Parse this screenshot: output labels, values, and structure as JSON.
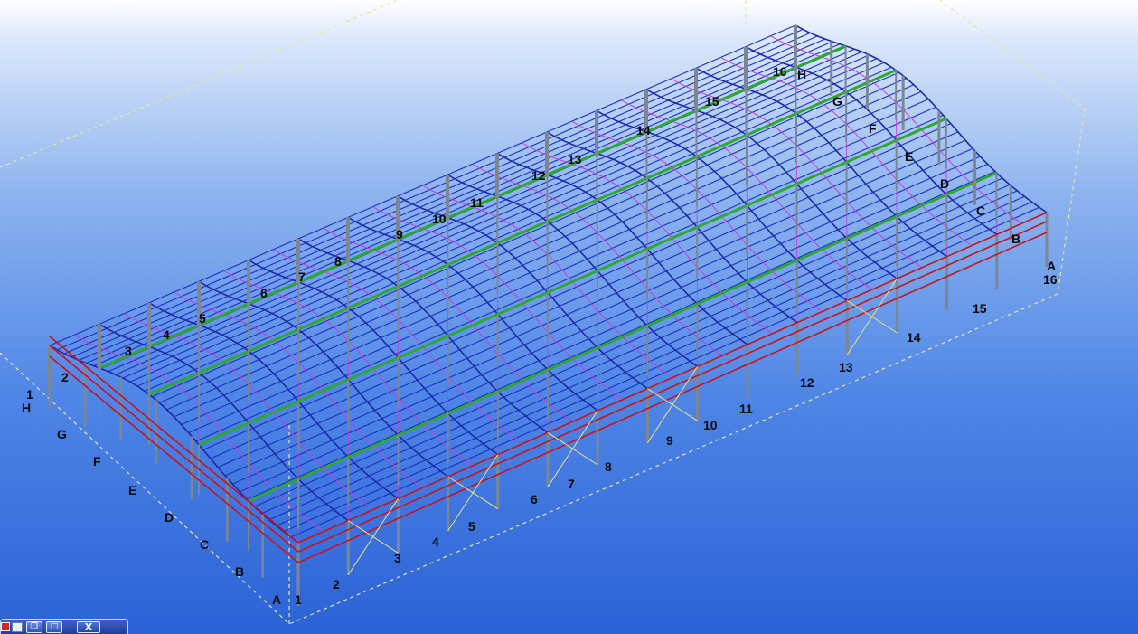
{
  "viewport": {
    "background_top": "#ffffff",
    "background_bottom": "#2b62d6"
  },
  "model_colors": {
    "rafter": "#1e2aa6",
    "purlin": "#1b2fc4",
    "secondary": "#c040d8",
    "eave_beam": "#c8141e",
    "ridge_beam": "#2da832",
    "column": "#7d8794",
    "bracing": "#e8e08a",
    "work_area": "#e6e6a0"
  },
  "grid_labels_axis": [
    {
      "text": "1"
    },
    {
      "text": "2"
    },
    {
      "text": "3"
    },
    {
      "text": "4"
    },
    {
      "text": "5"
    },
    {
      "text": "6"
    },
    {
      "text": "7"
    },
    {
      "text": "8"
    },
    {
      "text": "9"
    },
    {
      "text": "10"
    },
    {
      "text": "11"
    },
    {
      "text": "12"
    },
    {
      "text": "13"
    },
    {
      "text": "14"
    },
    {
      "text": "15"
    },
    {
      "text": "16"
    }
  ],
  "grid_labels_axis_far": [
    {
      "text": "2"
    },
    {
      "text": "3"
    },
    {
      "text": "4"
    },
    {
      "text": "5"
    },
    {
      "text": "6"
    },
    {
      "text": "7"
    },
    {
      "text": "8"
    },
    {
      "text": "9"
    },
    {
      "text": "10"
    },
    {
      "text": "11"
    },
    {
      "text": "12"
    },
    {
      "text": "13"
    },
    {
      "text": "14"
    },
    {
      "text": "15"
    },
    {
      "text": "16"
    }
  ],
  "grid_labels_letters_left": [
    {
      "text": "A"
    },
    {
      "text": "B"
    },
    {
      "text": "C"
    },
    {
      "text": "D"
    },
    {
      "text": "E"
    },
    {
      "text": "F"
    },
    {
      "text": "G"
    },
    {
      "text": "H"
    }
  ],
  "grid_labels_letters_right": [
    {
      "text": "A"
    },
    {
      "text": "B"
    },
    {
      "text": "C"
    },
    {
      "text": "D"
    },
    {
      "text": "E"
    },
    {
      "text": "F"
    },
    {
      "text": "G"
    },
    {
      "text": "H"
    }
  ],
  "left_top_label": "1",
  "minimized_window": {
    "icon": "app-icon",
    "doc_icon": "document-icon",
    "restore_label": "❐",
    "maximize_label": "□",
    "close_label": "X"
  }
}
